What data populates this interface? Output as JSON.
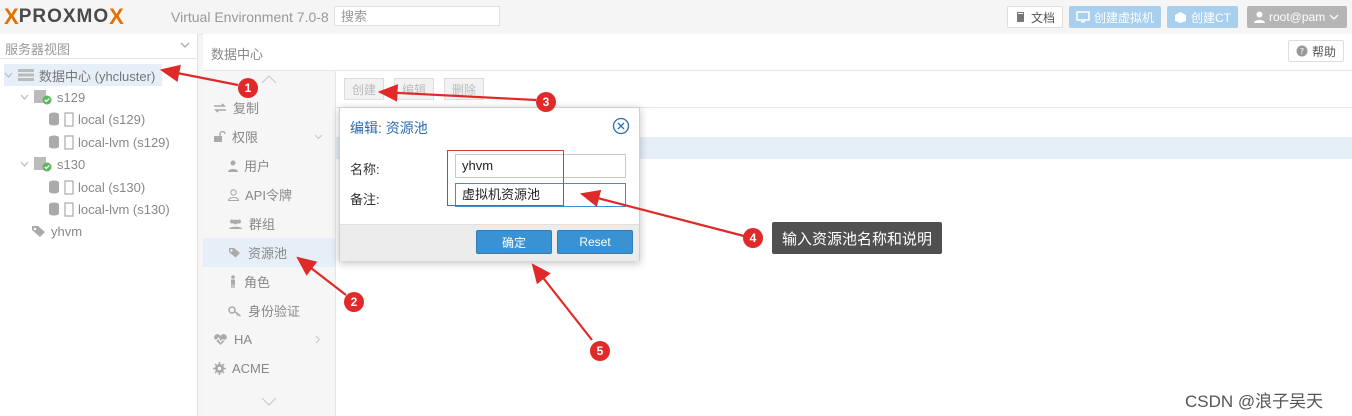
{
  "app": {
    "logo": {
      "x": "X",
      "brand_a": "PRO",
      "brand_b": "XMO",
      "brand_c": "X"
    },
    "version_text": "Virtual Environment 7.0-8",
    "search_placeholder": "搜索"
  },
  "topbar": {
    "docs_label": "文档",
    "create_vm_label": "创建虚拟机",
    "create_ct_label": "创建CT",
    "user_label": "root@pam"
  },
  "tree": {
    "view_label": "服务器视图",
    "datacenter": "数据中心 (yhcluster)",
    "nodes": [
      {
        "name": "s129",
        "storages": [
          "local (s129)",
          "local-lvm (s129)"
        ]
      },
      {
        "name": "s130",
        "storages": [
          "local (s130)",
          "local-lvm (s130)"
        ]
      }
    ],
    "pool": "yhvm"
  },
  "content": {
    "header_title": "数据中心",
    "help_label": "帮助"
  },
  "menu": {
    "items": [
      "复制",
      "权限",
      "用户",
      "API令牌",
      "群组",
      "资源池",
      "角色",
      "身份验证",
      "HA",
      "ACME"
    ]
  },
  "toolbar": {
    "create": "创建",
    "edit": "编辑",
    "delete": "删除"
  },
  "dialog": {
    "title": "编辑: 资源池",
    "name_label": "名称:",
    "name_value": "yhvm",
    "comment_label": "备注:",
    "comment_value": "虚拟机资源池",
    "ok_label": "确定",
    "reset_label": "Reset"
  },
  "annotations": {
    "badges": [
      "1",
      "2",
      "3",
      "4",
      "5"
    ],
    "tooltip": "输入资源池名称和说明",
    "arrow_color": "#e02a2a"
  },
  "watermark": "CSDN @浪子吴天"
}
